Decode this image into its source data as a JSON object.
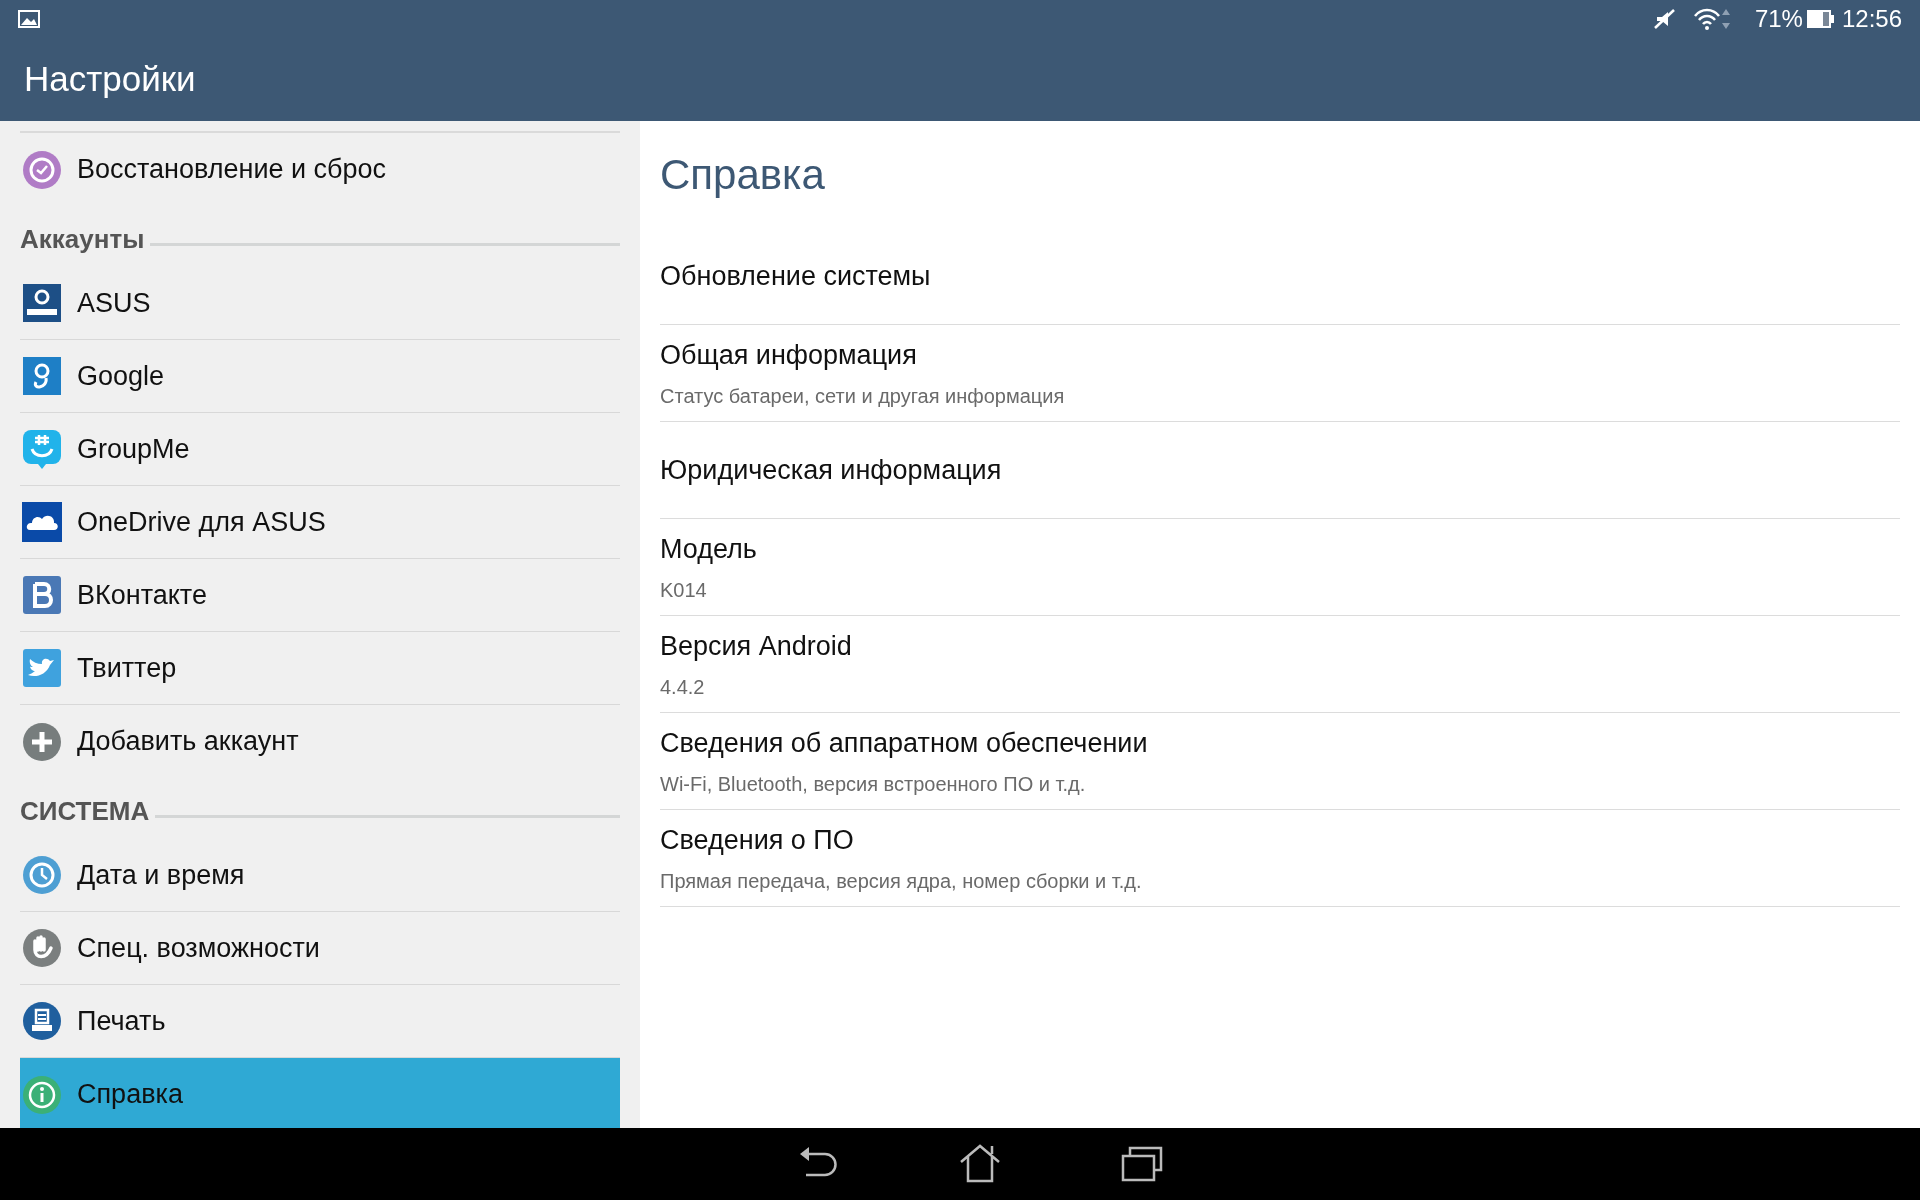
{
  "status_bar": {
    "battery_percent": "71%",
    "time": "12:56"
  },
  "header": {
    "title": "Настройки"
  },
  "sidebar": {
    "sections": [
      {
        "items": [
          {
            "label": "Восстановление и сброс",
            "selected": false
          }
        ]
      },
      {
        "title": "Аккаунты",
        "items": [
          {
            "label": "ASUS",
            "selected": false
          },
          {
            "label": "Google",
            "selected": false
          },
          {
            "label": "GroupMe",
            "selected": false
          },
          {
            "label": "OneDrive для ASUS",
            "selected": false
          },
          {
            "label": "ВКонтакте",
            "selected": false
          },
          {
            "label": "Твиттер",
            "selected": false
          },
          {
            "label": "Добавить аккаунт",
            "selected": false
          }
        ]
      },
      {
        "title": "СИСТЕМА",
        "items": [
          {
            "label": "Дата и время",
            "selected": false
          },
          {
            "label": "Спец. возможности",
            "selected": false
          },
          {
            "label": "Печать",
            "selected": false
          },
          {
            "label": "Справка",
            "selected": true
          }
        ]
      }
    ]
  },
  "detail": {
    "title": "Справка",
    "items": [
      {
        "title": "Обновление системы"
      },
      {
        "title": "Общая информация",
        "summary": "Статус батареи, сети и другая информация"
      },
      {
        "title": "Юридическая информация"
      },
      {
        "title": "Модель",
        "summary": "K014"
      },
      {
        "title": "Версия Android",
        "summary": "4.4.2"
      },
      {
        "title": "Сведения об аппаратном обеспечении",
        "summary": "Wi-Fi, Bluetooth, версия встроенного ПО и т.д."
      },
      {
        "title": "Сведения о ПО",
        "summary": "Прямая передача, версия ядра, номер сборки и т.д."
      }
    ]
  }
}
